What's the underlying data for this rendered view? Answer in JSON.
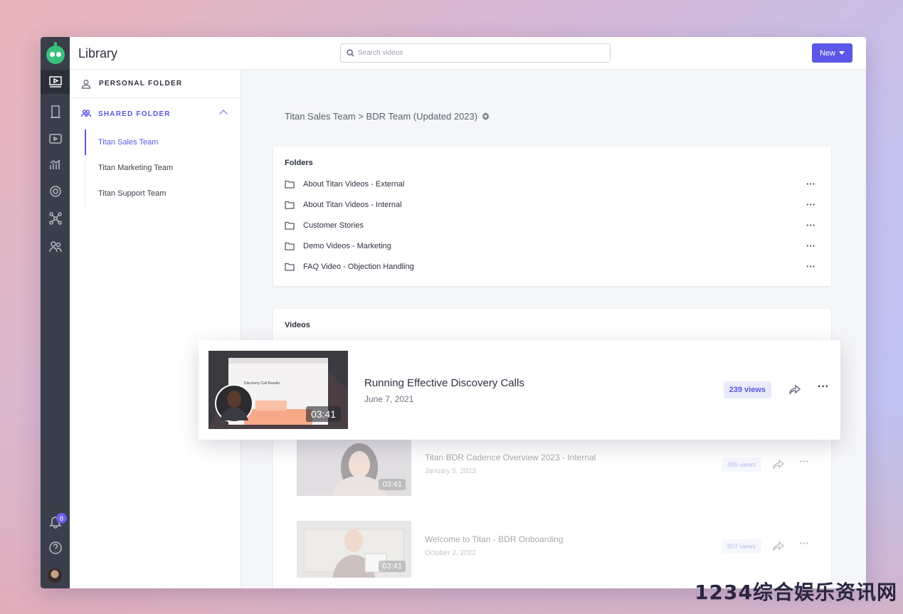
{
  "app": {
    "title": "Library"
  },
  "header": {
    "search_placeholder": "Search videos",
    "new_label": "New"
  },
  "rail": {
    "notifications_count": "8",
    "icons": [
      "library-icon",
      "bookmark-icon",
      "video-icon",
      "analytics-icon",
      "target-icon",
      "network-icon",
      "team-icon",
      "bell-icon",
      "help-icon",
      "avatar"
    ]
  },
  "sidebar": {
    "personal_label": "PERSONAL FOLDER",
    "shared_label": "SHARED FOLDER",
    "teams": [
      "Titan Sales Team",
      "Titan Marketing Team",
      "Titan Support Team"
    ]
  },
  "breadcrumb": "Titan Sales Team > BDR Team (Updated 2023)",
  "folders": {
    "heading": "Folders",
    "items": [
      "About Titan Videos - External",
      "About Titan Videos - Internal",
      "Customer Stories",
      "Demo Videos - Marketing",
      "FAQ Video - Objection Handling"
    ]
  },
  "videos": {
    "heading": "Videos",
    "featured": {
      "title": "Running Effective Discovery Calls",
      "date": "June 7, 2021",
      "views": "239 views",
      "duration": "03:41",
      "thumb_heading": "Discovery Call Results"
    },
    "items": [
      {
        "title": "Titan BDR Cadence Overview 2023 - Internal",
        "date": "January 5, 2023",
        "views": "456 views",
        "duration": "03:41"
      },
      {
        "title": "Welcome to Titan - BDR Onboarding",
        "date": "October 2, 2022",
        "views": "507 views",
        "duration": "03:41"
      }
    ]
  },
  "watermark": "1234综合娱乐资讯网",
  "colors": {
    "accent": "#5c57e6",
    "rail": "#3a3f4b",
    "logo": "#38c07a"
  }
}
